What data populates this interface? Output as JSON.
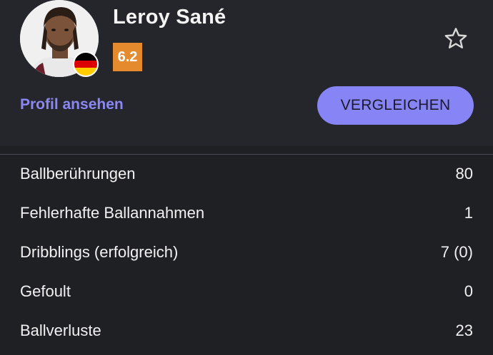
{
  "player": {
    "name": "Leroy Sané",
    "rating": "6.2",
    "rating_color": "#e68a2e",
    "nationality_flag": "germany-flag-icon",
    "flag_colors": [
      "#000000",
      "#dd0000",
      "#ffcc00"
    ]
  },
  "actions": {
    "profile_link": "Profil ansehen",
    "compare_button": "VERGLEICHEN",
    "favorite_icon": "star-outline-icon"
  },
  "colors": {
    "accent": "#8784f6",
    "background": "#1f2024",
    "header_background": "#25262b"
  },
  "stats": [
    {
      "label": "Ballberührungen",
      "value": "80"
    },
    {
      "label": "Fehlerhafte Ballannahmen",
      "value": "1"
    },
    {
      "label": "Dribblings (erfolgreich)",
      "value": "7 (0)"
    },
    {
      "label": "Gefoult",
      "value": "0"
    },
    {
      "label": "Ballverluste",
      "value": "23"
    }
  ]
}
